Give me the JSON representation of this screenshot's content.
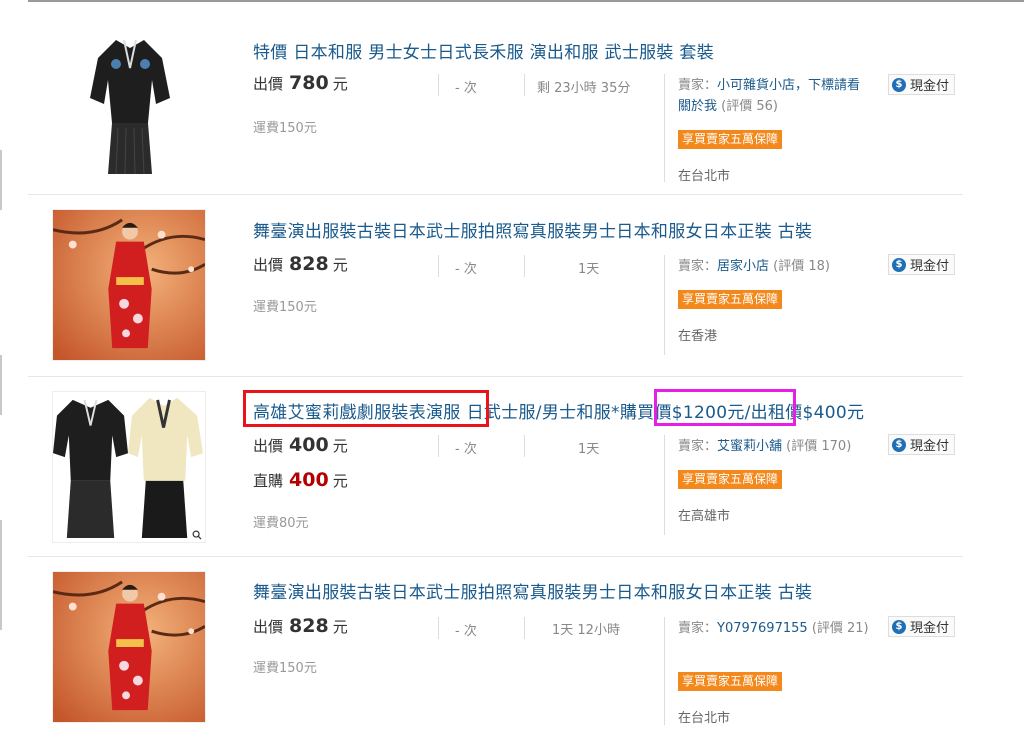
{
  "listings": [
    {
      "title": "特價 日本和服 男士女士日式長禾服 演出和服 武士服裝 套裝",
      "price_label": "出價",
      "price": "780",
      "unit": "元",
      "bids": "- 次",
      "time_left": "剩 23小時 35分",
      "shipping": "運費150元",
      "seller_prefix": "賣家：",
      "seller_name": "小可雜貨小店，下標請看關於我",
      "seller_rating": "(評價 56)",
      "badge": "享買賣家五萬保障",
      "location": "在台北市",
      "pay": "現金付"
    },
    {
      "title": "舞臺演出服裝古裝日本武士服拍照寫真服裝男士日本和服女日本正裝 古裝",
      "price_label": "出價",
      "price": "828",
      "unit": "元",
      "bids": "- 次",
      "time_left": "1天",
      "shipping": "運費150元",
      "seller_prefix": "賣家：",
      "seller_name": "居家小店",
      "seller_rating": "(評價 18)",
      "badge": "享買賣家五萬保障",
      "location": "在香港",
      "pay": "現金付"
    },
    {
      "title_part1": "高雄艾蜜莉戲劇服裝表演服",
      "title_part2": "日武士服/男士和服*",
      "title_part3": "購買價$1200元",
      "title_part4": "/出租價$400元",
      "price_label": "出價",
      "price": "400",
      "unit": "元",
      "direct_label": "直購",
      "direct_price": "400",
      "bids": "- 次",
      "time_left": "1天",
      "shipping": "運費80元",
      "seller_prefix": "賣家：",
      "seller_name": "艾蜜莉小舖",
      "seller_rating": "(評價 170)",
      "badge": "享買賣家五萬保障",
      "location": "在高雄市",
      "pay": "現金付"
    },
    {
      "title": "舞臺演出服裝古裝日本武士服拍照寫真服裝男士日本和服女日本正裝 古裝",
      "price_label": "出價",
      "price": "828",
      "unit": "元",
      "bids": "- 次",
      "time_left": "1天 12小時",
      "shipping": "運費150元",
      "seller_prefix": "賣家：",
      "seller_name": "Y0797697155",
      "seller_rating": "(評價 21)",
      "badge": "享買賣家五萬保障",
      "location": "在台北市",
      "pay": "現金付"
    }
  ],
  "colors": {
    "title_link": "#1a5a8c",
    "badge_bg": "#f3891d",
    "direct_price": "#b40000",
    "highlight_red": "#e8131b",
    "highlight_magenta": "#e61ee6"
  },
  "icons": {
    "pay_coin": "dollar-coin-icon",
    "zoom": "magnifier-icon"
  }
}
